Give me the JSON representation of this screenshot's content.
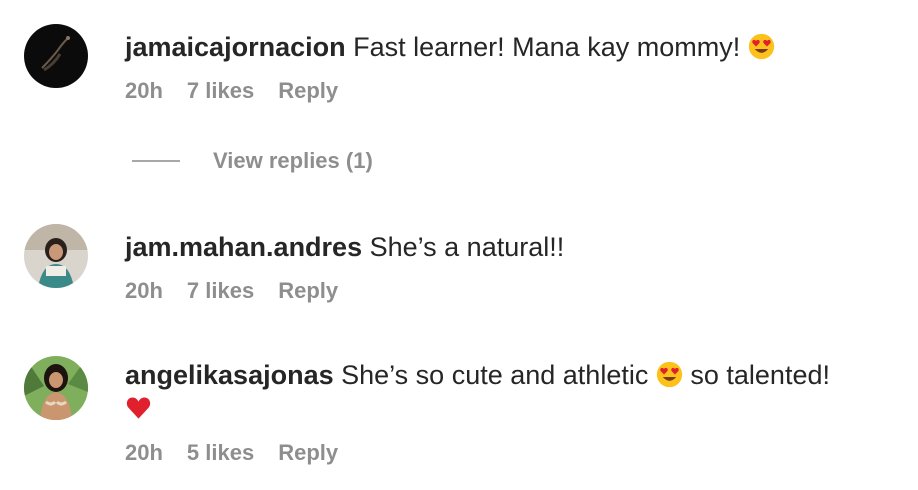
{
  "comments": [
    {
      "username": "jamaicajornacion",
      "text": "Fast learner! Mana kay mommy!",
      "time": "20h",
      "likes": "7 likes",
      "reply": "Reply"
    },
    {
      "username": "jam.mahan.andres",
      "text": "She’s a natural!!",
      "time": "20h",
      "likes": "7 likes",
      "reply": "Reply"
    },
    {
      "username": "angelikasajonas",
      "text_part1": "She’s so cute and athletic",
      "text_part2": "so talented!",
      "time": "20h",
      "likes": "5 likes",
      "reply": "Reply"
    }
  ],
  "view_replies": "View replies (1)",
  "icons": {
    "heart_eyes_emoji": "smiling-face-with-heart-eyes",
    "red_heart_emoji": "red-heart"
  },
  "colors": {
    "text": "#262626",
    "secondary": "#8e8e8e",
    "emoji_face": "#fcc21b",
    "heart": "#e0202d"
  }
}
